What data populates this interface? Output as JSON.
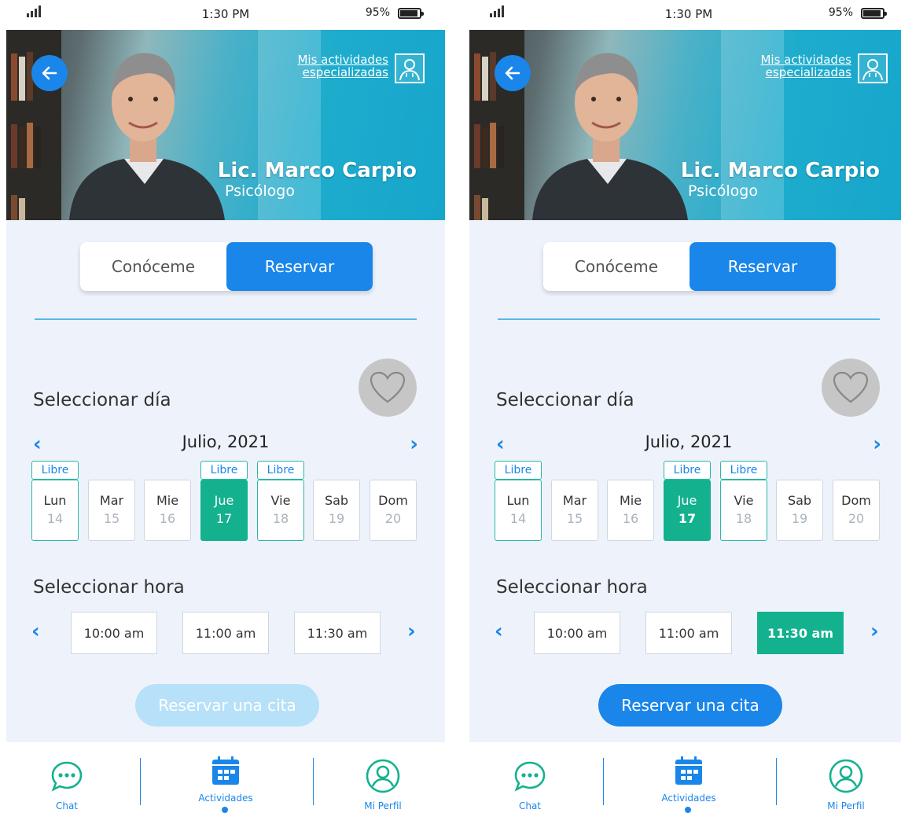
{
  "screens": [
    {
      "id": "a",
      "status": {
        "time": "1:30 PM",
        "battery": "95%"
      },
      "header": {
        "activities_line1": "Mis actividades",
        "activities_line2": "especializadas",
        "name": "Lic. Marco Carpio",
        "profession": "Psicólogo"
      },
      "segmented": {
        "left": "Conóceme",
        "right": "Reservar",
        "active": "right"
      },
      "select_day_title": "Seleccionar día",
      "month": "Julio, 2021",
      "days": [
        {
          "name": "Lun",
          "date": "14",
          "tag": "Libre"
        },
        {
          "name": "Mar",
          "date": "15",
          "tag": ""
        },
        {
          "name": "Mie",
          "date": "16",
          "tag": ""
        },
        {
          "name": "Jue",
          "date": "17",
          "tag": "Libre"
        },
        {
          "name": "Vie",
          "date": "18",
          "tag": "Libre"
        },
        {
          "name": "Sab",
          "date": "19",
          "tag": ""
        },
        {
          "name": "Dom",
          "date": "20",
          "tag": ""
        }
      ],
      "selected_day_index": 3,
      "select_hour_title": "Seleccionar hora",
      "hours": [
        "10:00 am",
        "11:00 am",
        "11:30 am"
      ],
      "selected_hour_index": -1,
      "book_button": {
        "label": "Reservar una cita",
        "state": "disabled"
      },
      "tabs": [
        {
          "label": "Chat",
          "icon": "chat-icon"
        },
        {
          "label": "Actividades",
          "icon": "calendar-icon"
        },
        {
          "label": "Mi Perfil",
          "icon": "user-icon"
        }
      ],
      "active_tab_index": 1
    },
    {
      "id": "b",
      "status": {
        "time": "1:30 PM",
        "battery": "95%"
      },
      "header": {
        "activities_line1": "Mis actividades",
        "activities_line2": "especializadas",
        "name": "Lic. Marco Carpio",
        "profession": "Psicólogo"
      },
      "segmented": {
        "left": "Conóceme",
        "right": "Reservar",
        "active": "right"
      },
      "select_day_title": "Seleccionar día",
      "month": "Julio, 2021",
      "days": [
        {
          "name": "Lun",
          "date": "14",
          "tag": "Libre"
        },
        {
          "name": "Mar",
          "date": "15",
          "tag": ""
        },
        {
          "name": "Mie",
          "date": "16",
          "tag": ""
        },
        {
          "name": "Jue",
          "date": "17",
          "tag": "Libre"
        },
        {
          "name": "Vie",
          "date": "18",
          "tag": "Libre"
        },
        {
          "name": "Sab",
          "date": "19",
          "tag": ""
        },
        {
          "name": "Dom",
          "date": "20",
          "tag": ""
        }
      ],
      "selected_day_index": 3,
      "select_hour_title": "Seleccionar hora",
      "hours": [
        "10:00 am",
        "11:00 am",
        "11:30 am"
      ],
      "selected_hour_index": 2,
      "book_button": {
        "label": "Reservar una cita",
        "state": "enabled"
      },
      "tabs": [
        {
          "label": "Chat",
          "icon": "chat-icon"
        },
        {
          "label": "Actividades",
          "icon": "calendar-icon"
        },
        {
          "label": "Mi Perfil",
          "icon": "user-icon"
        }
      ],
      "active_tab_index": 1
    }
  ],
  "colors": {
    "primary": "#1a86ea",
    "selected_green": "#14b18f",
    "free_border": "#2ab8a5",
    "disabled_button": "#b6e1f8",
    "background": "#eef3fb"
  }
}
